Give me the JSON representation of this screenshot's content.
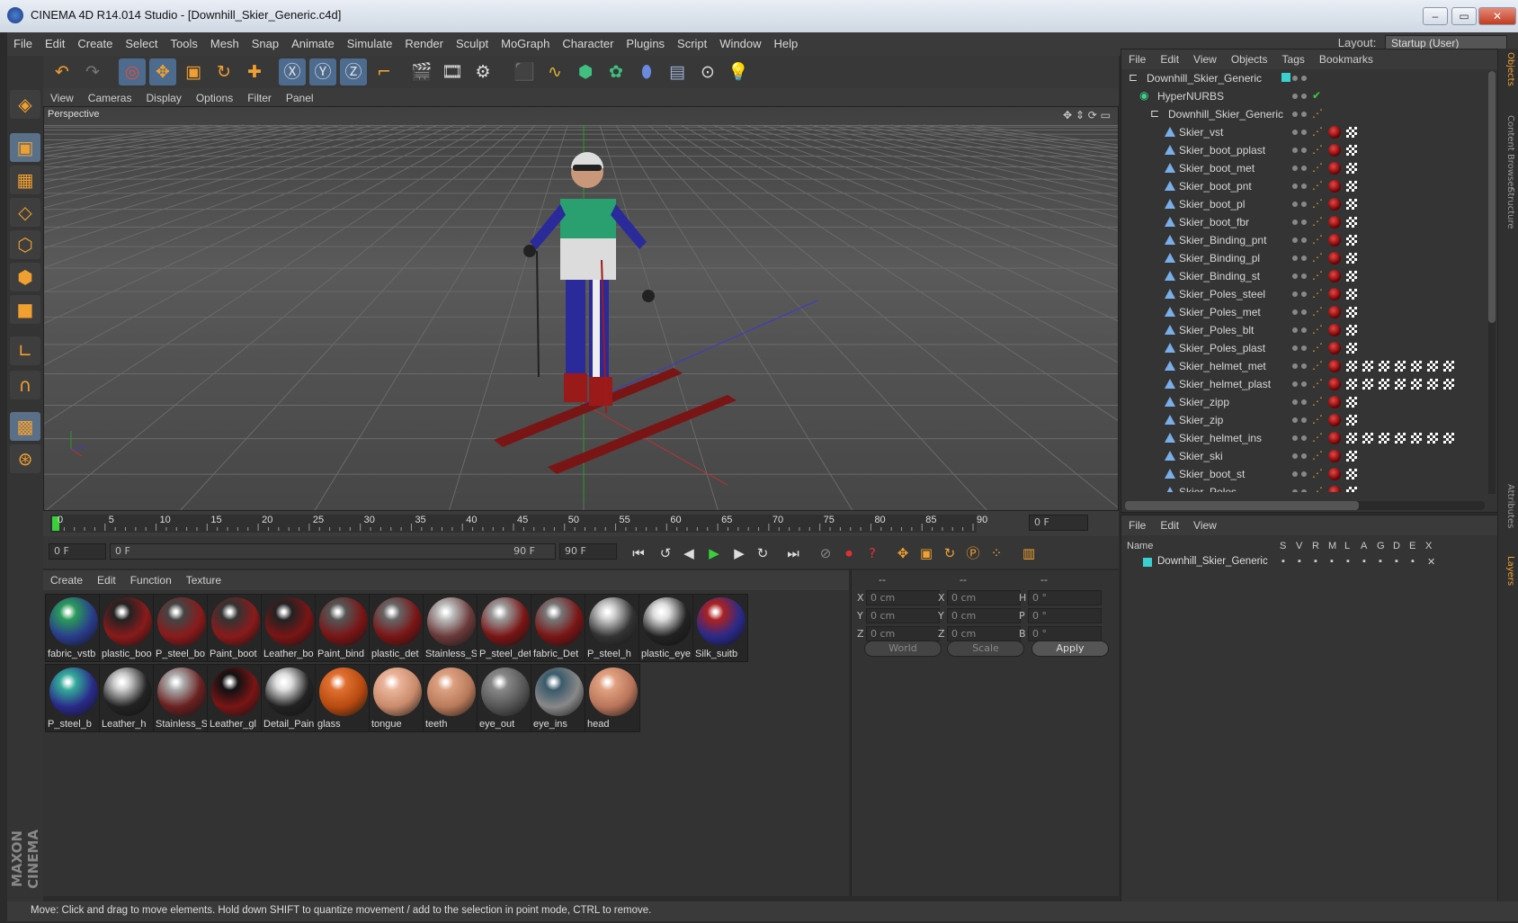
{
  "window": {
    "title": "CINEMA 4D R14.014 Studio - [Downhill_Skier_Generic.c4d]",
    "buttons": [
      "–",
      "▭",
      "✕"
    ]
  },
  "menubar": {
    "items": [
      "File",
      "Edit",
      "Create",
      "Select",
      "Tools",
      "Mesh",
      "Snap",
      "Animate",
      "Simulate",
      "Render",
      "Sculpt",
      "MoGraph",
      "Character",
      "Plugins",
      "Script",
      "Window",
      "Help"
    ],
    "layout_label": "Layout:",
    "layout_value": "Startup (User)"
  },
  "viewport": {
    "menu": [
      "View",
      "Cameras",
      "Display",
      "Options",
      "Filter",
      "Panel"
    ],
    "label": "Perspective"
  },
  "timeline": {
    "ticks": [
      "0",
      "5",
      "10",
      "15",
      "20",
      "25",
      "30",
      "35",
      "40",
      "45",
      "50",
      "55",
      "60",
      "65",
      "70",
      "75",
      "80",
      "85",
      "90"
    ],
    "current_frame": "0 F",
    "start_field": "0 F",
    "range_start": "0 F",
    "range_end": "90 F",
    "end_field": "90 F"
  },
  "materials": {
    "menu": [
      "Create",
      "Edit",
      "Function",
      "Texture"
    ],
    "items": [
      {
        "name": "fabric_vstb",
        "color": "#2a3c8c",
        "accent": "#2a9a5a"
      },
      {
        "name": "plastic_boo",
        "color": "#8a1a1a",
        "accent": "#222"
      },
      {
        "name": "P_steel_bo",
        "color": "#8a1a1a",
        "accent": "#444"
      },
      {
        "name": "Paint_boot",
        "color": "#8a1a1a",
        "accent": "#333"
      },
      {
        "name": "Leather_bo",
        "color": "#7a1515",
        "accent": "#222"
      },
      {
        "name": "Paint_bind",
        "color": "#7a1515",
        "accent": "#555"
      },
      {
        "name": "plastic_det",
        "color": "#7a1515",
        "accent": "#666"
      },
      {
        "name": "Stainless_S",
        "color": "#6a3a3a",
        "accent": "#bbb"
      },
      {
        "name": "P_steel_det",
        "color": "#7a1515",
        "accent": "#999"
      },
      {
        "name": "fabric_Det",
        "color": "#7a1515",
        "accent": "#777"
      },
      {
        "name": "P_steel_h",
        "color": "#333",
        "accent": "#ccc"
      },
      {
        "name": "plastic_eye",
        "color": "#222",
        "accent": "#ddd"
      },
      {
        "name": "Silk_suitb",
        "color": "#2a2a8a",
        "accent": "#a22"
      },
      {
        "name": "P_steel_b",
        "color": "#2a2a8a",
        "accent": "#3a9"
      },
      {
        "name": "Leather_h",
        "color": "#222",
        "accent": "#ccc"
      },
      {
        "name": "Stainless_S",
        "color": "#6a2020",
        "accent": "#aaa"
      },
      {
        "name": "Leather_gl",
        "color": "#7a1515",
        "accent": "#111"
      },
      {
        "name": "Detail_Pain",
        "color": "#222",
        "accent": "#ddd"
      },
      {
        "name": "glass",
        "color": "#b84a10",
        "accent": "#e07030"
      },
      {
        "name": "tongue",
        "color": "#c98a6a",
        "accent": "#eab49a"
      },
      {
        "name": "teeth",
        "color": "#b97a5a",
        "accent": "#dba080"
      },
      {
        "name": "eye_out",
        "color": "#555",
        "accent": "#888"
      },
      {
        "name": "eye_ins",
        "color": "#888",
        "accent": "#3a5a6a"
      },
      {
        "name": "head",
        "color": "#b9745a",
        "accent": "#e0a080"
      }
    ]
  },
  "coords": {
    "header": [
      "--",
      "--",
      "--"
    ],
    "rows": [
      {
        "a": "X",
        "av": "0 cm",
        "b": "X",
        "bv": "0 cm",
        "c": "H",
        "cv": "0 °"
      },
      {
        "a": "Y",
        "av": "0 cm",
        "b": "Y",
        "bv": "0 cm",
        "c": "P",
        "cv": "0 °"
      },
      {
        "a": "Z",
        "av": "0 cm",
        "b": "Z",
        "bv": "0 cm",
        "c": "B",
        "cv": "0 °"
      }
    ],
    "mode_world": "World",
    "mode_scale": "Scale",
    "apply": "Apply"
  },
  "objects": {
    "menu": [
      "File",
      "Edit",
      "View",
      "Objects",
      "Tags",
      "Bookmarks"
    ],
    "items": [
      {
        "name": "Downhill_Skier_Generic",
        "level": 0,
        "tags": 0
      },
      {
        "name": "HyperNURBS",
        "level": 1,
        "tags": 0
      },
      {
        "name": "Downhill_Skier_Generic",
        "level": 2,
        "tags": 0
      },
      {
        "name": "Skier_vst",
        "level": 3,
        "tags": 1
      },
      {
        "name": "Skier_boot_pplast",
        "level": 3,
        "tags": 1
      },
      {
        "name": "Skier_boot_met",
        "level": 3,
        "tags": 1
      },
      {
        "name": "Skier_boot_pnt",
        "level": 3,
        "tags": 1
      },
      {
        "name": "Skier_boot_pl",
        "level": 3,
        "tags": 1
      },
      {
        "name": "Skier_boot_fbr",
        "level": 3,
        "tags": 1
      },
      {
        "name": "Skier_Binding_pnt",
        "level": 3,
        "tags": 1
      },
      {
        "name": "Skier_Binding_pl",
        "level": 3,
        "tags": 1
      },
      {
        "name": "Skier_Binding_st",
        "level": 3,
        "tags": 1
      },
      {
        "name": "Skier_Poles_steel",
        "level": 3,
        "tags": 1
      },
      {
        "name": "Skier_Poles_met",
        "level": 3,
        "tags": 1
      },
      {
        "name": "Skier_Poles_blt",
        "level": 3,
        "tags": 1
      },
      {
        "name": "Skier_Poles_plast",
        "level": 3,
        "tags": 1
      },
      {
        "name": "Skier_helmet_met",
        "level": 3,
        "tags": 7
      },
      {
        "name": "Skier_helmet_plast",
        "level": 3,
        "tags": 7
      },
      {
        "name": "Skier_zipp",
        "level": 3,
        "tags": 1
      },
      {
        "name": "Skier_zip",
        "level": 3,
        "tags": 1
      },
      {
        "name": "Skier_helmet_ins",
        "level": 3,
        "tags": 7
      },
      {
        "name": "Skier_ski",
        "level": 3,
        "tags": 1
      },
      {
        "name": "Skier_boot_st",
        "level": 3,
        "tags": 1
      },
      {
        "name": "Skier_Poles",
        "level": 3,
        "tags": 1
      }
    ]
  },
  "layers": {
    "menu": [
      "File",
      "Edit",
      "View"
    ],
    "columns": [
      "Name",
      "S",
      "V",
      "R",
      "M",
      "L",
      "A",
      "G",
      "D",
      "E",
      "X"
    ],
    "rows": [
      {
        "name": "Downhill_Skier_Generic",
        "color": "#3ad0d0"
      }
    ]
  },
  "side_tabs": [
    "Objects",
    "Content Browser",
    "Structure",
    "Attributes",
    "Layers"
  ],
  "status": "Move: Click and drag to move elements. Hold down SHIFT to quantize movement / add to the selection in point mode, CTRL to remove.",
  "brand": "MAXON CINEMA 4D"
}
